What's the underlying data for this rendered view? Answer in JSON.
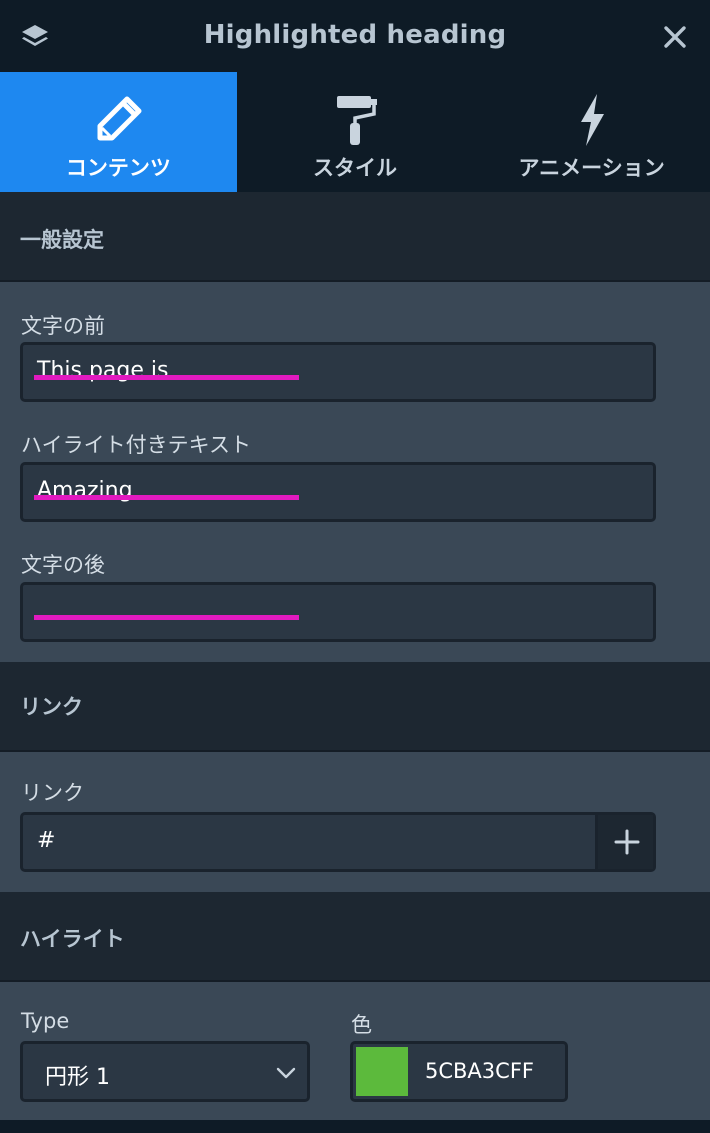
{
  "header": {
    "title": "Highlighted heading",
    "layers_icon": "layers-icon",
    "close_icon": "close-icon"
  },
  "tabs": [
    {
      "label": "コンテンツ",
      "icon": "pencil-icon",
      "active": true
    },
    {
      "label": "スタイル",
      "icon": "paint-roller-icon",
      "active": false
    },
    {
      "label": "アニメーション",
      "icon": "lightning-icon",
      "active": false
    }
  ],
  "sections": {
    "general": {
      "title": "一般設定",
      "before_label": "文字の前",
      "before_value": "This page is",
      "highlight_label": "ハイライト付きテキスト",
      "highlight_value": "Amazing",
      "after_label": "文字の後",
      "after_value": ""
    },
    "link": {
      "title": "リンク",
      "link_label": "リンク",
      "link_value": "#",
      "add_icon": "plus-icon"
    },
    "highlight": {
      "title": "ハイライト",
      "type_label": "Type",
      "type_value": "円形 1",
      "color_label": "色",
      "color_hex": "5CBA3CFF"
    }
  },
  "colors": {
    "accent": "#1e88f0",
    "swatch": "#5cba3c",
    "underline": "#e21ac0"
  }
}
